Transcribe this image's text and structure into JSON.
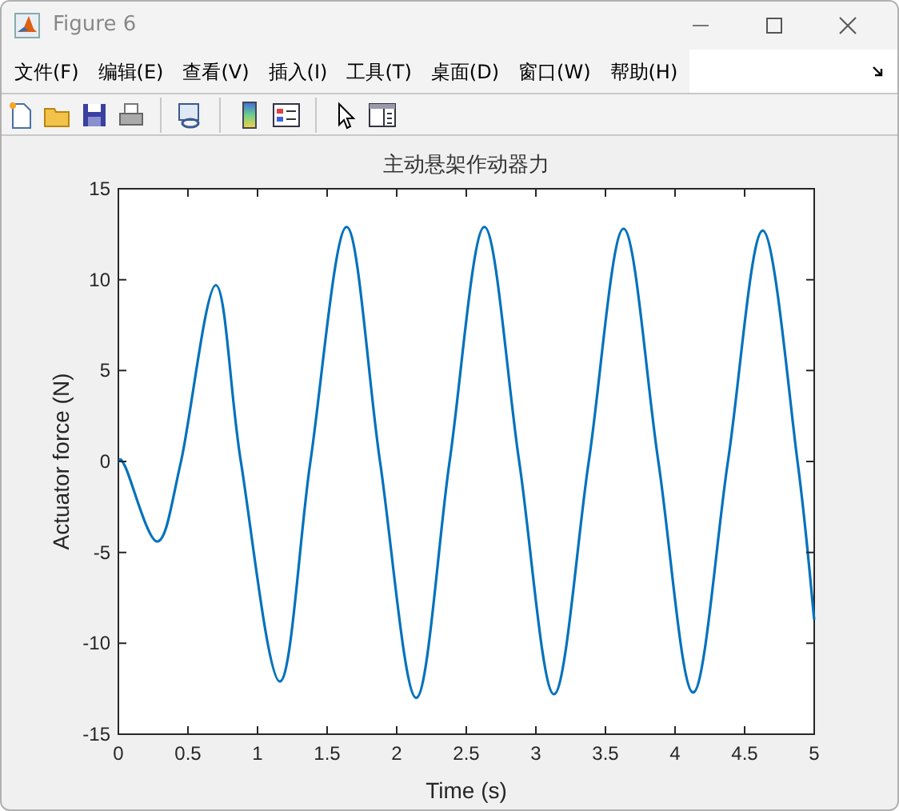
{
  "window": {
    "title": "Figure 6"
  },
  "menu": [
    "文件(F)",
    "编辑(E)",
    "查看(V)",
    "插入(I)",
    "工具(T)",
    "桌面(D)",
    "窗口(W)",
    "帮助(H)"
  ],
  "toolbar": [
    {
      "kind": "new"
    },
    {
      "kind": "open"
    },
    {
      "kind": "save"
    },
    {
      "kind": "print"
    },
    {
      "kind": "sep"
    },
    {
      "kind": "link"
    },
    {
      "kind": "sep"
    },
    {
      "kind": "colorbar"
    },
    {
      "kind": "legend"
    },
    {
      "kind": "sep"
    },
    {
      "kind": "pointer"
    },
    {
      "kind": "panel"
    }
  ],
  "figure": {
    "chart_data": {
      "type": "line",
      "title": "主动悬架作动器力",
      "xlabel": "Time (s)",
      "ylabel": "Actuator force (N)",
      "x": [
        0,
        0.05,
        0.28,
        0.45,
        0.7,
        0.88,
        1.16,
        1.38,
        1.64,
        1.88,
        2.14,
        2.38,
        2.63,
        2.88,
        3.13,
        3.38,
        3.63,
        3.88,
        4.13,
        4.38,
        4.63,
        4.88,
        5
      ],
      "series": [
        {
          "color": "#0072bd",
          "values": [
            0,
            -0.3,
            -4.4,
            0,
            9.7,
            0,
            -12.1,
            0,
            12.9,
            0,
            -13,
            0,
            12.9,
            0,
            -12.8,
            0,
            12.8,
            0,
            -12.7,
            0,
            12.7,
            0,
            -8.7
          ]
        }
      ],
      "xlim": [
        0,
        5
      ],
      "ylim": [
        -15,
        15
      ],
      "xticks": [
        0,
        0.5,
        1,
        1.5,
        2,
        2.5,
        3,
        3.5,
        4,
        4.5,
        5
      ],
      "yticks": [
        -15,
        -10,
        -5,
        0,
        5,
        10,
        15
      ]
    }
  }
}
